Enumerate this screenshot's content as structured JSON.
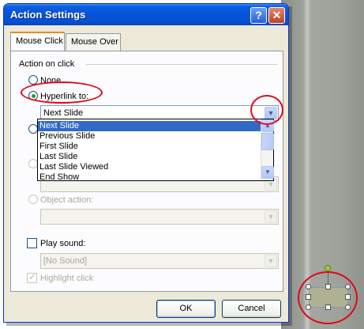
{
  "dialog": {
    "title": "Action Settings",
    "help_button": "?",
    "close_button": "✕",
    "ok_label": "OK",
    "cancel_label": "Cancel"
  },
  "tabs": [
    {
      "label": "Mouse Click",
      "active": true
    },
    {
      "label": "Mouse Over",
      "active": false
    }
  ],
  "action": {
    "group_label": "Action on click",
    "none_label": "None",
    "hyperlink_label": "Hyperlink to:",
    "hyperlink_value": "Next Slide",
    "object_action_label": "Object action:"
  },
  "dropdown": {
    "items": [
      "Next Slide",
      "Previous Slide",
      "First Slide",
      "Last Slide",
      "Last Slide Viewed",
      "End Show"
    ],
    "selected_index": 0
  },
  "sound": {
    "play_sound_label": "Play sound:",
    "sound_value": "[No Sound]",
    "highlight_click_label": "Highlight click"
  },
  "icons": {
    "chevron": "chevron-down-icon",
    "scroll_up": "scroll-up-icon",
    "scroll_down": "scroll-down-icon"
  },
  "colors": {
    "title_bar": "#0654d8",
    "dialog_bg": "#ece9d8",
    "selection": "#316ac5",
    "highlight_circle": "#e0081f",
    "radio_check": "#21a121",
    "shape_fill": "#b0b190",
    "rotation_handle": "#8fd432"
  }
}
